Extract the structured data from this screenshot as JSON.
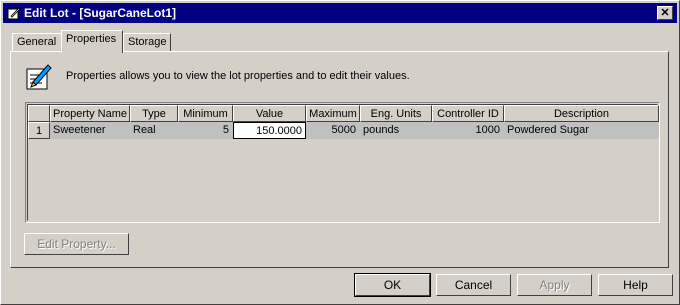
{
  "window": {
    "title": "Edit Lot - [SugarCaneLot1]",
    "close_glyph": "✕"
  },
  "tabs": [
    {
      "label": "General"
    },
    {
      "label": "Properties"
    },
    {
      "label": "Storage"
    }
  ],
  "info": {
    "text": "Properties allows you to view the lot properties and to edit their values.",
    "icon": "lot-properties-icon"
  },
  "grid": {
    "columns": [
      "Property Name",
      "Type",
      "Minimum",
      "Value",
      "Maximum",
      "Eng. Units",
      "Controller ID",
      "Description"
    ],
    "rows": [
      {
        "index": "1",
        "property_name": "Sweetener",
        "type": "Real",
        "minimum": "5",
        "value": "150.0000",
        "maximum": "5000",
        "eng_units": "pounds",
        "controller_id": "1000",
        "description": "Powdered Sugar"
      }
    ]
  },
  "buttons": {
    "edit_property": "Edit Property...",
    "ok": "OK",
    "cancel": "Cancel",
    "apply": "Apply",
    "help": "Help"
  }
}
